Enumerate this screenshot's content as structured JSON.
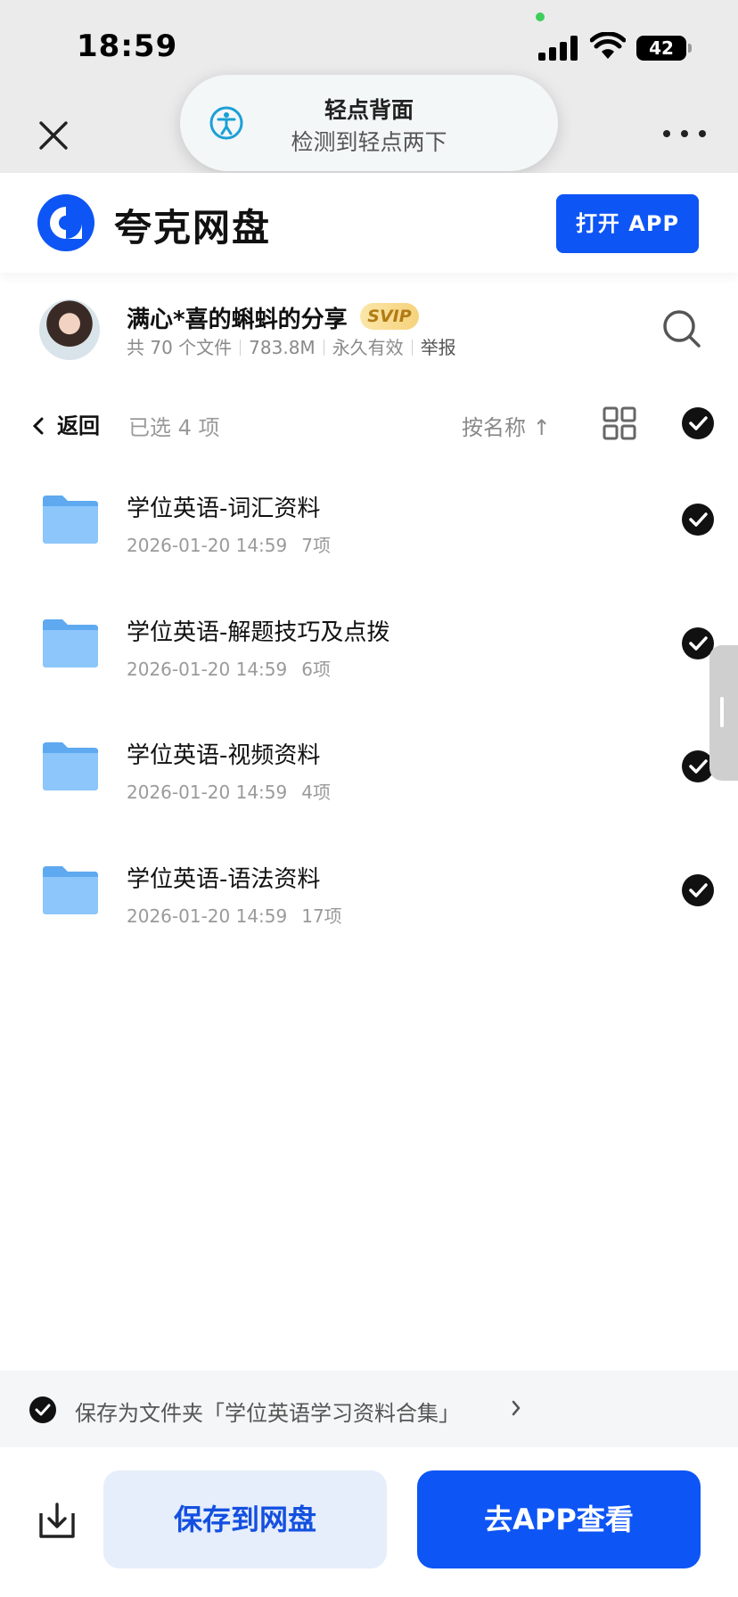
{
  "status_bar": {
    "time": "18:59",
    "battery": "42"
  },
  "toast": {
    "title": "轻点背面",
    "subtitle": "检测到轻点两下"
  },
  "brand": {
    "name": "夸克网盘",
    "open_app": "打开 APP",
    "accent": "#0d55f5"
  },
  "share": {
    "title": "满心*喜的蝌蚪的分享",
    "badge": "SVIP",
    "file_count": "共 70 个文件",
    "size": "783.8M",
    "validity": "永久有效",
    "report": "举报"
  },
  "toolbar": {
    "back": "返回",
    "selected": "已选 4 项",
    "sort": "按名称 ↑"
  },
  "files": [
    {
      "name": "学位英语-词汇资料",
      "date": "2026-01-20 14:59",
      "count": "7项",
      "checked": true
    },
    {
      "name": "学位英语-解题技巧及点拨",
      "date": "2026-01-20 14:59",
      "count": "6项",
      "checked": true
    },
    {
      "name": "学位英语-视频资料",
      "date": "2026-01-20 14:59",
      "count": "4项",
      "checked": true
    },
    {
      "name": "学位英语-语法资料",
      "date": "2026-01-20 14:59",
      "count": "17项",
      "checked": true
    }
  ],
  "bottom": {
    "save_as_folder": "保存为文件夹「学位英语学习资料合集」",
    "save_button": "保存到网盘",
    "open_app_button": "去APP查看"
  }
}
